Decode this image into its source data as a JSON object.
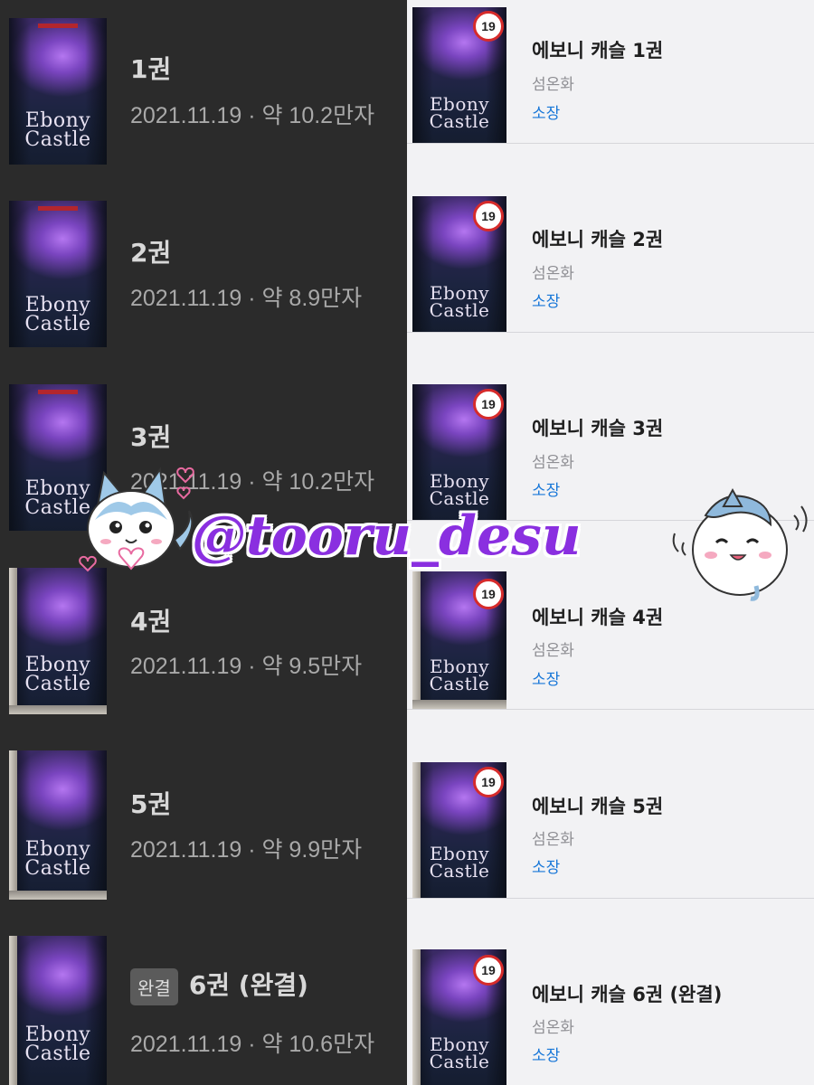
{
  "left_list": [
    {
      "title": "1권",
      "meta": "2021.11.19 · 약 10.2만자",
      "badge": ""
    },
    {
      "title": "2권",
      "meta": "2021.11.19 · 약 8.9만자",
      "badge": ""
    },
    {
      "title": "3권",
      "meta": "2021.11.19 · 약 10.2만자",
      "badge": ""
    },
    {
      "title": "4권",
      "meta": "2021.11.19 · 약 9.5만자",
      "badge": ""
    },
    {
      "title": "5권",
      "meta": "2021.11.19 · 약 9.9만자",
      "badge": ""
    },
    {
      "title": "6권 (완결)",
      "meta": "2021.11.19 · 약 10.6만자",
      "badge": "완결"
    }
  ],
  "right_list": [
    {
      "title": "에보니 캐슬 1권",
      "author": "섬온화",
      "status": "소장",
      "age": "19"
    },
    {
      "title": "에보니 캐슬 2권",
      "author": "섬온화",
      "status": "소장",
      "age": "19"
    },
    {
      "title": "에보니 캐슬 3권",
      "author": "섬온화",
      "status": "소장",
      "age": "19"
    },
    {
      "title": "에보니 캐슬 4권",
      "author": "섬온화",
      "status": "소장",
      "age": "19"
    },
    {
      "title": "에보니 캐슬 5권",
      "author": "섬온화",
      "status": "소장",
      "age": "19"
    },
    {
      "title": "에보니 캐슬 6권 (완결)",
      "author": "섬온화",
      "status": "소장",
      "age": "19"
    }
  ],
  "cover_title": "Ebony\nCastle",
  "watermark": "@tooru_desu",
  "colors": {
    "left_bg": "#2b2b2b",
    "right_bg": "#f2f2f4",
    "link_blue": "#1877d8",
    "age_red": "#d62b2b",
    "watermark_purple": "#8a2fe0"
  }
}
